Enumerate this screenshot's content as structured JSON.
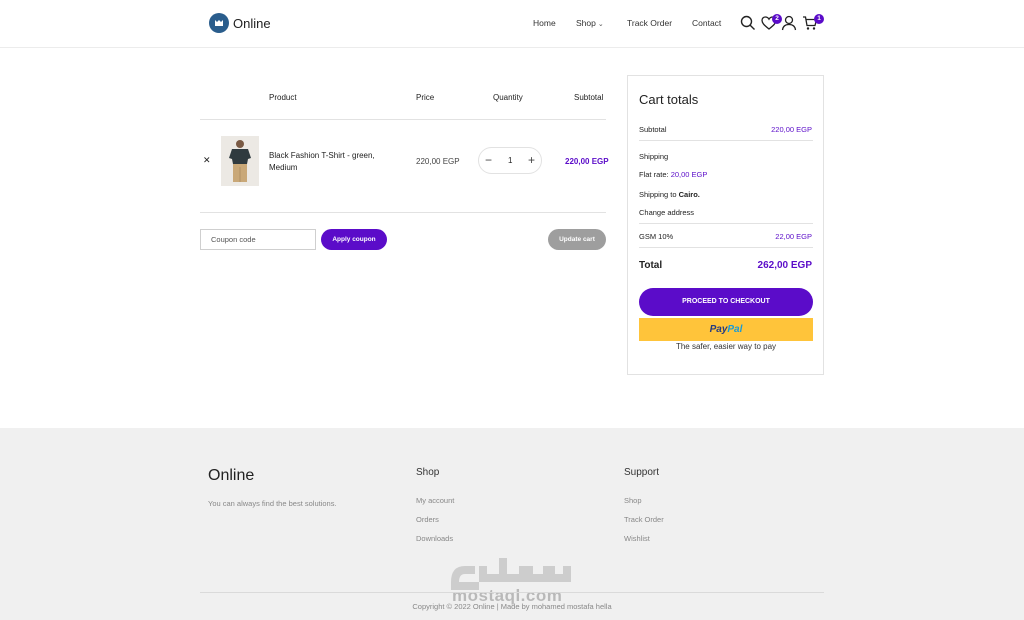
{
  "brand": {
    "name": "Online"
  },
  "nav": {
    "items": [
      {
        "label": "Home"
      },
      {
        "label": "Shop"
      },
      {
        "label": "Track Order"
      },
      {
        "label": "Contact"
      }
    ]
  },
  "header_icons": {
    "search": "search-icon",
    "wishlist": {
      "icon": "heart-icon",
      "count": "2"
    },
    "account": "user-icon",
    "cart": {
      "icon": "cart-icon",
      "count": "1"
    }
  },
  "cart": {
    "columns": [
      "Product",
      "Price",
      "Quantity",
      "Subtotal"
    ],
    "items": [
      {
        "name": "Black Fashion T-Shirt - green, Medium",
        "price": "220,00 EGP",
        "quantity": "1",
        "subtotal": "220,00 EGP"
      }
    ],
    "coupon_placeholder": "Coupon code",
    "apply_label": "Apply coupon",
    "update_label": "Update cart"
  },
  "totals": {
    "title": "Cart totals",
    "subtotal_label": "Subtotal",
    "subtotal_value": "220,00 EGP",
    "shipping_label": "Shipping",
    "flat_rate_label": "Flat rate:",
    "flat_rate_value": "20,00 EGP",
    "shipping_to_label": "Shipping to",
    "shipping_to_city": "Cairo.",
    "change_address": "Change address",
    "tax_label": "GSM 10%",
    "tax_value": "22,00 EGP",
    "total_label": "Total",
    "total_value": "262,00 EGP",
    "checkout_label": "PROCEED TO CHECKOUT",
    "paypal_part1": "Pay",
    "paypal_part2": "Pal",
    "paypal_tagline": "The safer, easier way to pay"
  },
  "footer": {
    "brand": "Online",
    "tagline": "You can always find the best solutions.",
    "shop_heading": "Shop",
    "shop_links": [
      "My account",
      "Orders",
      "Downloads"
    ],
    "support_heading": "Support",
    "support_links": [
      "Shop",
      "Track Order",
      "Wishlist"
    ],
    "copyright": "Copyright © 2022 Online | Made by mohamed mostafa hella",
    "watermark_text": "mostaql.com"
  },
  "colors": {
    "accent": "#5b0cc9",
    "update_button": "#9e9e9e",
    "paypal_yellow": "#ffc43a",
    "footer_bg": "#f0f0f0"
  }
}
